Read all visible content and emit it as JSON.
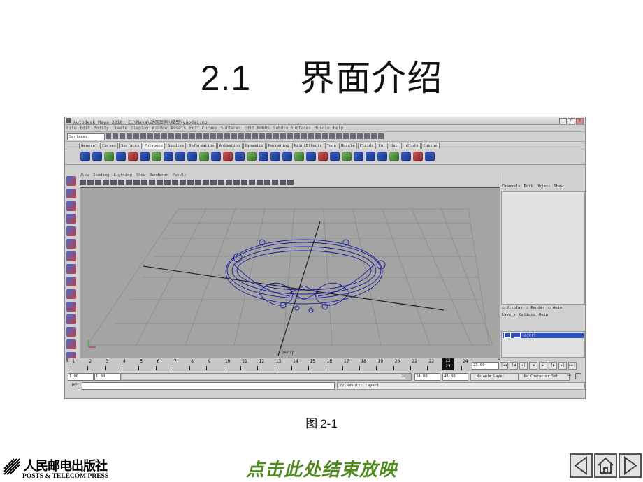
{
  "slide": {
    "title_number": "2.1",
    "title_text": "界面介绍",
    "caption_label": "图",
    "caption_number": "2-1",
    "end_show": "点击此处结束放映",
    "publisher_cn": "人民邮电出版社",
    "publisher_en": "POSTS & TELECOM PRESS"
  },
  "maya": {
    "window_title": "Autodesk Maya 2010: E:\\Maya\\动画案例\\模型\\yaodai.mb",
    "menus": [
      "File",
      "Edit",
      "Modify",
      "Create",
      "Display",
      "Window",
      "Assets",
      "Edit Curves",
      "Surfaces",
      "Edit NURBS",
      "Subdiv Surfaces",
      "Muscle",
      "Help"
    ],
    "mode": "Surfaces",
    "shelf_tabs": [
      "General",
      "Curves",
      "Surfaces",
      "Polygons",
      "Subdivs",
      "Deformation",
      "Animation",
      "Dynamics",
      "Rendering",
      "PaintEffects",
      "Toon",
      "Muscle",
      "Fluids",
      "Fur",
      "Hair",
      "nCloth",
      "Custom"
    ],
    "active_shelf_tab": "Polygons",
    "panel_menus": [
      "View",
      "Shading",
      "Lighting",
      "Show",
      "Renderer",
      "Panels"
    ],
    "camera_label": "persp",
    "channel_menus": [
      "Channels",
      "Edit",
      "Object",
      "Show"
    ],
    "layer_radios": [
      "Display",
      "Render",
      "Anim"
    ],
    "layer_menus": [
      "Layers",
      "Options",
      "Help"
    ],
    "layer_name": "layer1",
    "time_ticks": [
      "1",
      "2",
      "3",
      "4",
      "5",
      "6",
      "7",
      "8",
      "9",
      "10",
      "11",
      "12",
      "13",
      "14",
      "15",
      "16",
      "17",
      "18",
      "19",
      "20",
      "21",
      "22",
      "23",
      "24"
    ],
    "current_frame": "23",
    "current_frame_field": "23.00",
    "range_start": "1.00",
    "range_start_inner": "1.00",
    "range_end_inner": "24.00",
    "range_end": "48.00",
    "range_handle_end": "24",
    "anim_layer": "No Anim Layer",
    "char_set": "No Character Set",
    "cmd_label": "MEL",
    "result": "// Result: layer1"
  }
}
